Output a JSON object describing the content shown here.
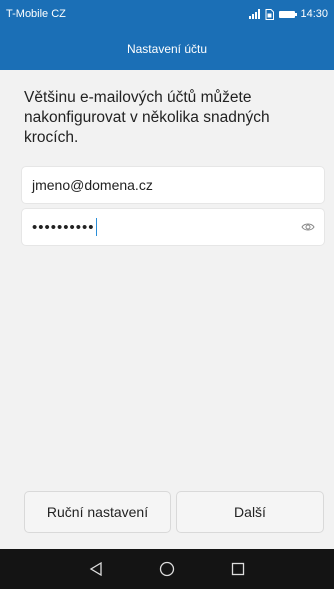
{
  "status_bar": {
    "carrier": "T-Mobile CZ",
    "time": "14:30"
  },
  "header": {
    "title": "Nastavení účtu"
  },
  "intro_text": "Většinu e-mailových účtů můžete nakonfigurovat v několika snadných krocích.",
  "email_field": {
    "value": "jmeno@domena.cz"
  },
  "password_field": {
    "value": "••••••••••",
    "toggle_icon": "eye-icon"
  },
  "buttons": {
    "manual_label": "Ruční nastavení",
    "next_label": "Další"
  },
  "nav_icons": [
    "back-icon",
    "home-icon",
    "recents-icon"
  ],
  "colors": {
    "accent": "#1b6fb6",
    "navbar": "#141414",
    "caret": "#2a8ed8"
  }
}
